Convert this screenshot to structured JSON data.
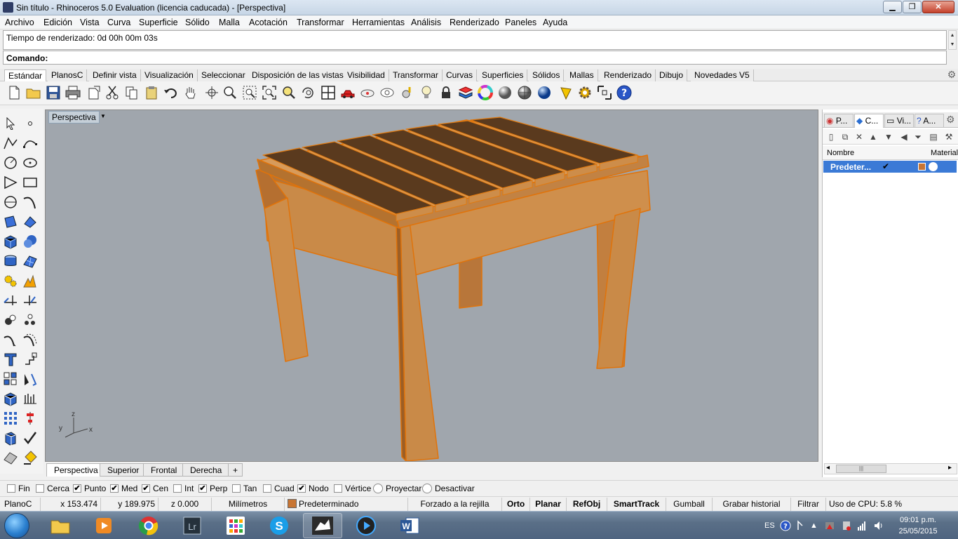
{
  "window": {
    "title": "Sin título - Rhinoceros 5.0 Evaluation (licencia caducada) - [Perspectiva]",
    "min_glyph": "▁",
    "max_glyph": "❐",
    "close_glyph": "✕"
  },
  "menu": [
    "Archivo",
    "Edición",
    "Vista",
    "Curva",
    "Superficie",
    "Sólido",
    "Malla",
    "Acotación",
    "Transformar",
    "Herramientas",
    "Análisis",
    "Renderizado",
    "Paneles",
    "Ayuda"
  ],
  "command": {
    "history_text": "Tiempo de renderizado: 0d 00h 00m 03s",
    "prompt_label": "Comando:",
    "input_value": ""
  },
  "toolbar_tabs": [
    "Estándar",
    "PlanosC",
    "Definir vista",
    "Visualización",
    "Seleccionar",
    "Disposición de las vistas",
    "Visibilidad",
    "Transformar",
    "Curvas",
    "Superficies",
    "Sólidos",
    "Mallas",
    "Renderizado",
    "Dibujo",
    "Novedades V5"
  ],
  "toolbar_tools": [
    "new-file",
    "open-file",
    "save",
    "print",
    "import",
    "cut",
    "copy",
    "paste",
    "undo",
    "pan",
    "rotate-view",
    "zoom-dynamic",
    "zoom-window",
    "zoom-extents",
    "zoom-selected",
    "rotate-camera",
    "four-viewports",
    "car-object",
    "snapshot",
    "point-lens",
    "light-bulb",
    "lock",
    "layer",
    "color-wheel",
    "sphere-render",
    "sphere-shaded",
    "sphere-blue",
    "filter-pick",
    "gear-settings",
    "gumball-tool",
    "help"
  ],
  "left_tools": [
    "select-arrow",
    "point",
    "polyline",
    "curve-points",
    "circle",
    "ellipse",
    "polygon",
    "rectangle",
    "arc-center",
    "arc-edit",
    "surface-corner",
    "surface-edit",
    "box-solid",
    "sphere-solid",
    "extrude",
    "mesh-plane",
    "explode-gear",
    "boolean-burst",
    "trim",
    "split",
    "group-object",
    "ungroup",
    "fillet-curve",
    "offset-curve",
    "text-object",
    "dim-tool",
    "array-rect",
    "mirror",
    "cube-plane",
    "hatch",
    "grid-array",
    "align",
    "bool-union",
    "check-mark",
    "wedge",
    "paint-bucket"
  ],
  "viewport": {
    "title": "Perspectiva",
    "axis_z": "z",
    "axis_y": "y",
    "axis_x": "x",
    "background_color": "#a0a6ad",
    "wood_color": "#cd8d4a",
    "plank_color": "#5a3a1e",
    "edge_color": "#e07a10"
  },
  "viewport_tabs": [
    "Perspectiva",
    "Superior",
    "Frontal",
    "Derecha"
  ],
  "viewport_tab_add": "+",
  "panel": {
    "tabs": [
      "P...",
      "C...",
      "Vi...",
      "A..."
    ],
    "col_name": "Nombre",
    "col_material": "Material",
    "row_name": "Predeter...",
    "row_check": "✔",
    "row_color": "#c87533",
    "scroll_left": "◂",
    "scroll_right": "▸",
    "scroll_grip": "|||"
  },
  "osnaps": [
    {
      "label": "Fin",
      "checked": false
    },
    {
      "label": "Cerca",
      "checked": false
    },
    {
      "label": "Punto",
      "checked": true
    },
    {
      "label": "Med",
      "checked": true
    },
    {
      "label": "Cen",
      "checked": true
    },
    {
      "label": "Int",
      "checked": false
    },
    {
      "label": "Perp",
      "checked": true
    },
    {
      "label": "Tan",
      "checked": false
    },
    {
      "label": "Cuad",
      "checked": false
    },
    {
      "label": "Nodo",
      "checked": true
    },
    {
      "label": "Vértice",
      "checked": false
    }
  ],
  "osnap_radios": [
    "Proyectar",
    "Desactivar"
  ],
  "status": {
    "cplane": "PlanoC",
    "x": "x 153.474",
    "y": "y 189.975",
    "z": "z 0.000",
    "units": "Milímetros",
    "layer": "Predeterminado",
    "layer_color": "#c87533",
    "grid_snap": "Forzado a la rejilla",
    "ortho": "Orto",
    "planar": "Planar",
    "osnap": "RefObj",
    "smarttrack": "SmartTrack",
    "gumball": "Gumball",
    "history": "Grabar historial",
    "filter": "Filtrar",
    "cpu": "Uso de CPU: 5.8 %"
  },
  "taskbar": {
    "apps": [
      "file-explorer",
      "media-player",
      "chrome",
      "lightroom",
      "app-grid",
      "skype",
      "rhino",
      "media-center",
      "word"
    ],
    "lang": "ES",
    "time": "09:01 p.m.",
    "date": "25/05/2015"
  }
}
